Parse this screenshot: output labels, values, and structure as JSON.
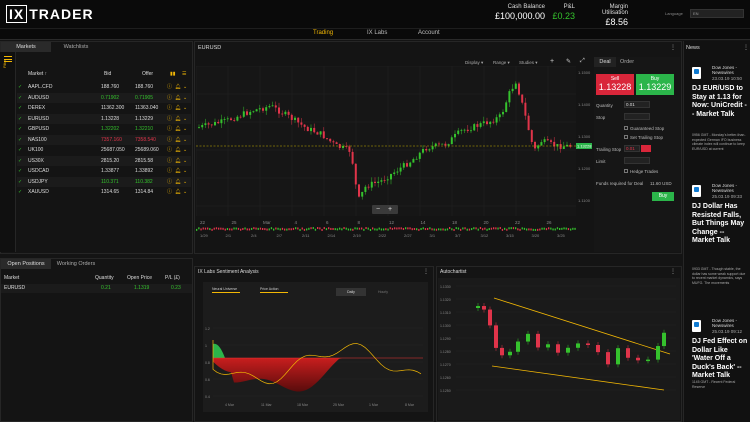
{
  "app": {
    "brand_ix": "IX",
    "brand_rest": "TRADER"
  },
  "header": {
    "cash_label": "Cash Balance",
    "cash_value": "£100,000.00",
    "pl_label": "P&L",
    "pl_value": "£0.23",
    "margin_label": "Margin Utilisation",
    "margin_value": "£8.56",
    "account_label": "Language",
    "account_value": "EN"
  },
  "nav": {
    "tabs": [
      "Trading",
      "IX Labs",
      "Account"
    ]
  },
  "watchlist": {
    "tabs": [
      "Markets",
      "Watchlists"
    ],
    "columns": [
      "Market ↑",
      "Bid",
      "Offer"
    ],
    "rows": [
      {
        "market": "AAPL.CFD",
        "bid": "188.760",
        "offer": "188.760",
        "dir": "wh"
      },
      {
        "market": "AUDUSD",
        "bid": "0.71902",
        "offer": "0.71905",
        "dir": "up"
      },
      {
        "market": "DEREX",
        "bid": "11362.300",
        "offer": "11363.040",
        "dir": "wh"
      },
      {
        "market": "EURUSD",
        "bid": "1.13228",
        "offer": "1.13229",
        "dir": "wh"
      },
      {
        "market": "GBPUSD",
        "bid": "1.32202",
        "offer": "1.32210",
        "dir": "up"
      },
      {
        "market": "NAS100",
        "bid": "7357.160",
        "offer": "7358.540",
        "dir": "dn"
      },
      {
        "market": "UK100",
        "bid": "25687.050",
        "offer": "25689.060",
        "dir": "wh"
      },
      {
        "market": "US30X",
        "bid": "2815.20",
        "offer": "2815.58",
        "dir": "wh"
      },
      {
        "market": "USDCAD",
        "bid": "1.33877",
        "offer": "1.33892",
        "dir": "wh"
      },
      {
        "market": "USDJPY",
        "bid": "110.371",
        "offer": "110.382",
        "dir": "up"
      },
      {
        "market": "XAUUSD",
        "bid": "1314.65",
        "offer": "1314.84",
        "dir": "wh"
      }
    ]
  },
  "positions": {
    "tabs": [
      "Open Positions",
      "Working Orders"
    ],
    "columns": [
      "Market",
      "Quantity",
      "Open Price",
      "P/L (£)"
    ],
    "rows": [
      {
        "market": "EURUSD",
        "qty": "0.21",
        "price": "1.1319",
        "pl": "0.23"
      }
    ]
  },
  "main_chart": {
    "title": "EURUSD",
    "toolbar": [
      "Display ▾",
      "Range ▾",
      "Studies ▾"
    ],
    "price_labels": [
      "1.1500",
      "1.1400",
      "1.1300",
      "1.1200",
      "1.1100"
    ],
    "time_labels": [
      "22",
      "25",
      "Mar",
      "4",
      "6",
      "8",
      "12",
      "14",
      "18",
      "20",
      "22",
      "26"
    ],
    "date_labels": [
      "1/29",
      "2/1",
      "2/4",
      "2/7",
      "2/11",
      "2/14",
      "2/19",
      "2/22",
      "2/27",
      "3/1",
      "3/7",
      "3/12",
      "3/15",
      "3/20",
      "3/25"
    ],
    "last_price": "1.13228"
  },
  "deal": {
    "tabs": [
      "Deal",
      "Order"
    ],
    "sell_label": "Sell",
    "sell_price": "1.13228",
    "buy_label": "Buy",
    "buy_price": "1.13229",
    "qty_label": "Quantity",
    "qty_value": "0.01",
    "stop_label": "Stop",
    "gs_label": "Guaranteed Stop",
    "tr_label": "Set Trailing Stop",
    "trail_label": "Trailing Stop",
    "trail_value": "0.01",
    "limit_label": "Limit",
    "hedge_label": "Hedge Trades",
    "funds_label": "Funds required for Deal",
    "funds_value": "11.60 USD",
    "submit_label": "Buy"
  },
  "news": {
    "title": "News",
    "items": [
      {
        "source": "Dow Jones - Newswires",
        "time": "23.03.19 10:50",
        "title": "DJ EUR/USD to Stay at 1.13 for Now: UniCredit -- Market Talk",
        "body": "0956 GMT - Monday's better-than-expected German IFO business climate index will continue to keep EUR/USD at current"
      },
      {
        "source": "Dow Jones - Newswires",
        "time": "25.03.19 09:33",
        "title": "DJ Dollar Has Resisted Falls, But Things May Change -- Market Talk",
        "body": "0933 GMT - Though stable, the dollar has some weak support due to recent market dynamics, says MUFG. The movements"
      },
      {
        "source": "Dow Jones - Newswires",
        "time": "25.03.19 09:12",
        "title": "DJ Fed Effect on Dollar Like 'Water Off a Duck's Back' -- Market Talk",
        "body": "1145 GMT - Recent Federal Reserve"
      }
    ]
  },
  "sentiment": {
    "title": "IX Labs Sentiment Analysis",
    "legend": [
      "Neural Universe",
      "Price Action"
    ],
    "toggle": [
      "Daily",
      "Hourly"
    ],
    "y_labels": [
      "1.2",
      "1",
      "0.8",
      "0.6",
      "0.4"
    ],
    "x_labels": [
      "4 Mar",
      "11 Mar",
      "18 Mar",
      "25 Mar",
      "1 Mar",
      "8 Mar"
    ]
  },
  "autochartist": {
    "title": "Autochartist",
    "y_labels": [
      "1.1330",
      "1.1320",
      "1.1310",
      "1.1300",
      "1.1290",
      "1.1280",
      "1.1270",
      "1.1260",
      "1.1250"
    ]
  },
  "colors": {
    "accent": "#f2b705",
    "up": "#35c22d",
    "down": "#e0344a",
    "sell": "#d9263a",
    "buy": "#2bb54a"
  },
  "chart_data": [
    {
      "type": "candlestick",
      "title": "EURUSD",
      "y_range": [
        1.11,
        1.15
      ],
      "last": 1.13228
    },
    {
      "type": "area",
      "title": "IX Labs Sentiment Analysis",
      "series": [
        {
          "name": "Neural Universe"
        },
        {
          "name": "Price Action"
        }
      ]
    },
    {
      "type": "candlestick",
      "title": "Autochartist",
      "y_range": [
        1.125,
        1.133
      ]
    }
  ]
}
